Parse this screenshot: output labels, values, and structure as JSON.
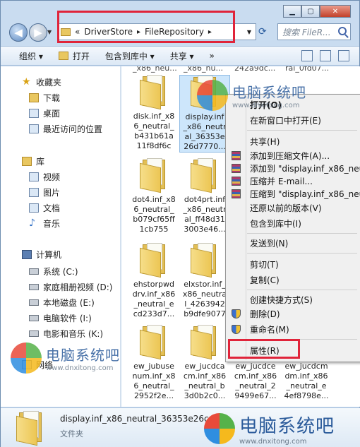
{
  "address": {
    "prefix": "«",
    "crumbs": [
      "DriverStore",
      "FileRepository"
    ],
    "sep": "▸",
    "search_placeholder": "搜索 FileR..."
  },
  "toolbar": {
    "organize": "组织 ▾",
    "open": "打开",
    "include": "包含到库中 ▾",
    "share": "共享 ▾",
    "more": "»"
  },
  "sidebar": {
    "favorites": "收藏夹",
    "downloads": "下载",
    "desktop": "桌面",
    "recent": "最近访问的位置",
    "libraries": "库",
    "videos": "视频",
    "pictures": "图片",
    "documents": "文档",
    "music": "音乐",
    "computer": "计算机",
    "drive_c": "系统 (C:)",
    "drive_d": "家庭相册视频 (D:)",
    "drive_e": "本地磁盘 (E:)",
    "drive_i": "电脑软件 (I:)",
    "drive_k": "电影和音乐 (K:)",
    "network": "网络"
  },
  "files": {
    "top_partial_1": "_x86_neu...",
    "top_partial_2": "_x86_nu...",
    "top_partial_3": "242a9dc...",
    "top_partial_4": "ral_0fd07...",
    "disk": "disk.inf_x8\n6_neutral_\nb431b61a\n11f8df6c",
    "display": "display.inf\n_x86_neutr\nal_36353e\n26d7770...",
    "dot4": "dot4.inf_x8\n6_neutral_\nb079cf65ff\n1cb755",
    "dot4prt": "dot4prt.inf\n_x86_neutr\nal_ff48d31\n3003e46...",
    "ehstor": "ehstorpwd\ndrv.inf_x86\n_neutral_e\ncd233d7...",
    "elxstor": "elxstor.inf_\nx86_neutra\nl_4263942\nb9dfe9077",
    "jubuse": "ew_jubuse\nnum.inf_x8\n6_neutral_\n2952f2e...",
    "jucdca": "ew_jucdca\ncm.inf_x86\n_neutral_b\n3d0b2c0...",
    "jucdce": "ew_jucdce\ncm.inf_x86\n_neutral_2\n9499e67...",
    "jucdcm": "ew_jucdcm\ndm.inf_x86\n_neutral_e\n4ef8798e..."
  },
  "menu": {
    "open": "打开(O)",
    "open_new": "在新窗口中打开(E)",
    "share": "共享(H)",
    "add_archive": "添加到压缩文件(A)...",
    "add_named": "添加到 \"display.inf_x86_neut",
    "compress_email": "压缩并 E-mail...",
    "compress_named": "压缩到 \"display.inf_x86_neutr",
    "restore": "还原以前的版本(V)",
    "include_lib": "包含到库中(I)",
    "send_to": "发送到(N)",
    "cut": "剪切(T)",
    "copy": "复制(C)",
    "shortcut": "创建快捷方式(S)",
    "delete": "删除(D)",
    "rename": "重命名(M)",
    "properties": "属性(R)"
  },
  "details": {
    "name": "display.inf_x86_neutral_36353e26c",
    "type": "文件夹"
  },
  "watermark": {
    "title": "电脑系统吧",
    "url": "www.dnxitong.com"
  },
  "colors": {
    "highlight": "#e0243a",
    "window_frame": "#c9dcf0",
    "selection": "#cde6fb"
  }
}
